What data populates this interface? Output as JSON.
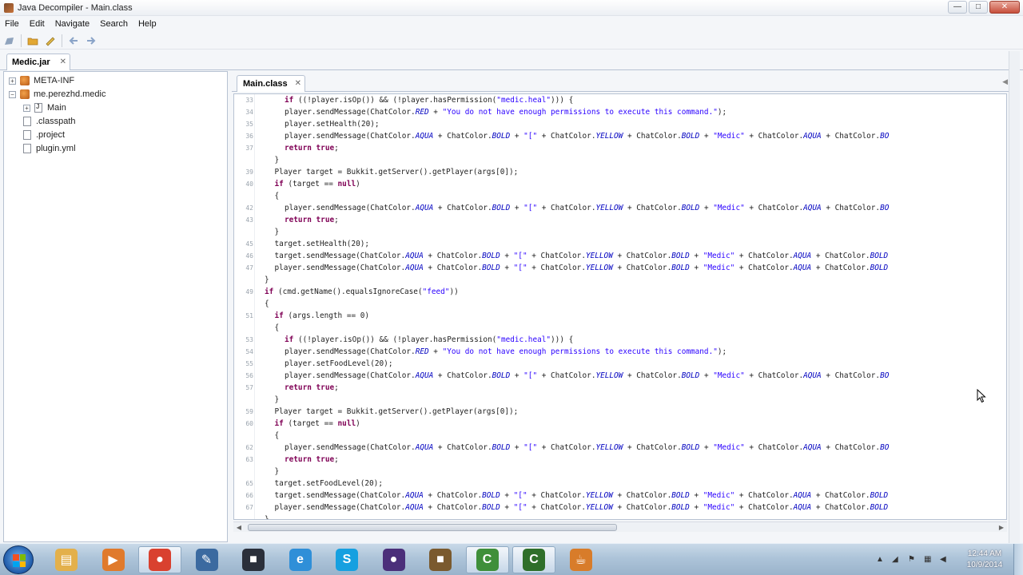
{
  "window": {
    "title": "Java Decompiler - Main.class",
    "buttons": {
      "minimize": "—",
      "maximize": "□",
      "close": "✕"
    }
  },
  "menu": [
    "File",
    "Edit",
    "Navigate",
    "Search",
    "Help"
  ],
  "toolbar": {
    "icons": [
      "open-file-icon",
      "folder-icon",
      "jar-icon",
      "back-arrow-icon",
      "forward-arrow-icon"
    ]
  },
  "doc_tab": {
    "label": "Medic.jar",
    "close": "✕"
  },
  "tree": {
    "nodes": [
      {
        "label": "META-INF",
        "type": "package",
        "expander": "+"
      },
      {
        "label": "me.perezhd.medic",
        "type": "package",
        "expander": "−"
      },
      {
        "label": "Main",
        "type": "java",
        "expander": "+"
      },
      {
        "label": ".classpath",
        "type": "file"
      },
      {
        "label": ".project",
        "type": "file"
      },
      {
        "label": "plugin.yml",
        "type": "file"
      }
    ]
  },
  "editor": {
    "tab_label": "Main.class",
    "tab_close": "✕",
    "lines": [
      {
        "ln": "33",
        "indent": 4,
        "code": "if ((!player.isOp()) && (!player.hasPermission(\"medic.heal\"))) {"
      },
      {
        "ln": "34",
        "indent": 4,
        "code": "player.sendMessage(ChatColor.RED + \"You do not have enough permissions to execute this command.\");"
      },
      {
        "ln": "35",
        "indent": 4,
        "code": "player.setHealth(20);"
      },
      {
        "ln": "36",
        "indent": 4,
        "code": "player.sendMessage(ChatColor.AQUA + ChatColor.BOLD + \"[\" + ChatColor.YELLOW + ChatColor.BOLD + \"Medic\" + ChatColor.AQUA + ChatColor.BO"
      },
      {
        "ln": "37",
        "indent": 4,
        "code": "return true;"
      },
      {
        "ln": "",
        "indent": 3,
        "code": "}"
      },
      {
        "ln": "39",
        "indent": 3,
        "code": "Player target = Bukkit.getServer().getPlayer(args[0]);"
      },
      {
        "ln": "40",
        "indent": 3,
        "code": "if (target == null)"
      },
      {
        "ln": "",
        "indent": 3,
        "code": "{"
      },
      {
        "ln": "42",
        "indent": 4,
        "code": "player.sendMessage(ChatColor.AQUA + ChatColor.BOLD + \"[\" + ChatColor.YELLOW + ChatColor.BOLD + \"Medic\" + ChatColor.AQUA + ChatColor.BO"
      },
      {
        "ln": "43",
        "indent": 4,
        "code": "return true;"
      },
      {
        "ln": "",
        "indent": 3,
        "code": "}"
      },
      {
        "ln": "45",
        "indent": 3,
        "code": "target.setHealth(20);"
      },
      {
        "ln": "46",
        "indent": 3,
        "code": "target.sendMessage(ChatColor.AQUA + ChatColor.BOLD + \"[\" + ChatColor.YELLOW + ChatColor.BOLD + \"Medic\" + ChatColor.AQUA + ChatColor.BOLD"
      },
      {
        "ln": "47",
        "indent": 3,
        "code": "player.sendMessage(ChatColor.AQUA + ChatColor.BOLD + \"[\" + ChatColor.YELLOW + ChatColor.BOLD + \"Medic\" + ChatColor.AQUA + ChatColor.BOLD"
      },
      {
        "ln": "",
        "indent": 2,
        "code": "}"
      },
      {
        "ln": "49",
        "indent": 2,
        "code": "if (cmd.getName().equalsIgnoreCase(\"feed\"))"
      },
      {
        "ln": "",
        "indent": 2,
        "code": "{"
      },
      {
        "ln": "51",
        "indent": 3,
        "code": "if (args.length == 0)"
      },
      {
        "ln": "",
        "indent": 3,
        "code": "{"
      },
      {
        "ln": "53",
        "indent": 4,
        "code": "if ((!player.isOp()) && (!player.hasPermission(\"medic.heal\"))) {"
      },
      {
        "ln": "54",
        "indent": 4,
        "code": "player.sendMessage(ChatColor.RED + \"You do not have enough permissions to execute this command.\");"
      },
      {
        "ln": "55",
        "indent": 4,
        "code": "player.setFoodLevel(20);"
      },
      {
        "ln": "56",
        "indent": 4,
        "code": "player.sendMessage(ChatColor.AQUA + ChatColor.BOLD + \"[\" + ChatColor.YELLOW + ChatColor.BOLD + \"Medic\" + ChatColor.AQUA + ChatColor.BO"
      },
      {
        "ln": "57",
        "indent": 4,
        "code": "return true;"
      },
      {
        "ln": "",
        "indent": 3,
        "code": "}"
      },
      {
        "ln": "59",
        "indent": 3,
        "code": "Player target = Bukkit.getServer().getPlayer(args[0]);"
      },
      {
        "ln": "60",
        "indent": 3,
        "code": "if (target == null)"
      },
      {
        "ln": "",
        "indent": 3,
        "code": "{"
      },
      {
        "ln": "62",
        "indent": 4,
        "code": "player.sendMessage(ChatColor.AQUA + ChatColor.BOLD + \"[\" + ChatColor.YELLOW + ChatColor.BOLD + \"Medic\" + ChatColor.AQUA + ChatColor.BO"
      },
      {
        "ln": "63",
        "indent": 4,
        "code": "return true;"
      },
      {
        "ln": "",
        "indent": 3,
        "code": "}"
      },
      {
        "ln": "65",
        "indent": 3,
        "code": "target.setFoodLevel(20);"
      },
      {
        "ln": "66",
        "indent": 3,
        "code": "target.sendMessage(ChatColor.AQUA + ChatColor.BOLD + \"[\" + ChatColor.YELLOW + ChatColor.BOLD + \"Medic\" + ChatColor.AQUA + ChatColor.BOLD"
      },
      {
        "ln": "67",
        "indent": 3,
        "code": "player.sendMessage(ChatColor.AQUA + ChatColor.BOLD + \"[\" + ChatColor.YELLOW + ChatColor.BOLD + \"Medic\" + ChatColor.AQUA + ChatColor.BOLD"
      },
      {
        "ln": "",
        "indent": 2,
        "code": "}"
      }
    ]
  },
  "colors": {
    "keyword": "#7f0055",
    "string": "#2a00ff",
    "field": "#0000c0",
    "accent": "#8fc7e6"
  },
  "taskbar": {
    "apps": [
      {
        "name": "explorer-icon",
        "glyph": "▤",
        "color": "#e3b04b"
      },
      {
        "name": "media-player-icon",
        "glyph": "▶",
        "color": "#e07a2c"
      },
      {
        "name": "chrome-icon",
        "glyph": "●",
        "color": "#d9412f",
        "active": true
      },
      {
        "name": "pen-tool-icon",
        "glyph": "✎",
        "color": "#3b6aa0"
      },
      {
        "name": "camera-icon",
        "glyph": "■",
        "color": "#2a2f3a"
      },
      {
        "name": "ie-icon",
        "glyph": "e",
        "color": "#2f8fd8"
      },
      {
        "name": "skype-icon",
        "glyph": "S",
        "color": "#16a0e0"
      },
      {
        "name": "eclipse-icon",
        "glyph": "●",
        "color": "#4b2f7a"
      },
      {
        "name": "minecraft-icon",
        "glyph": "■",
        "color": "#7a5a2e"
      },
      {
        "name": "camtasia-icon",
        "glyph": "C",
        "color": "#3f8f3a",
        "active": true
      },
      {
        "name": "java-decompiler-icon",
        "glyph": "C",
        "color": "#2f6f2a",
        "active": true
      },
      {
        "name": "java-icon",
        "glyph": "☕",
        "color": "#d87c2a"
      }
    ],
    "clock_time": "12:44 AM",
    "clock_date": "10/9/2014"
  }
}
